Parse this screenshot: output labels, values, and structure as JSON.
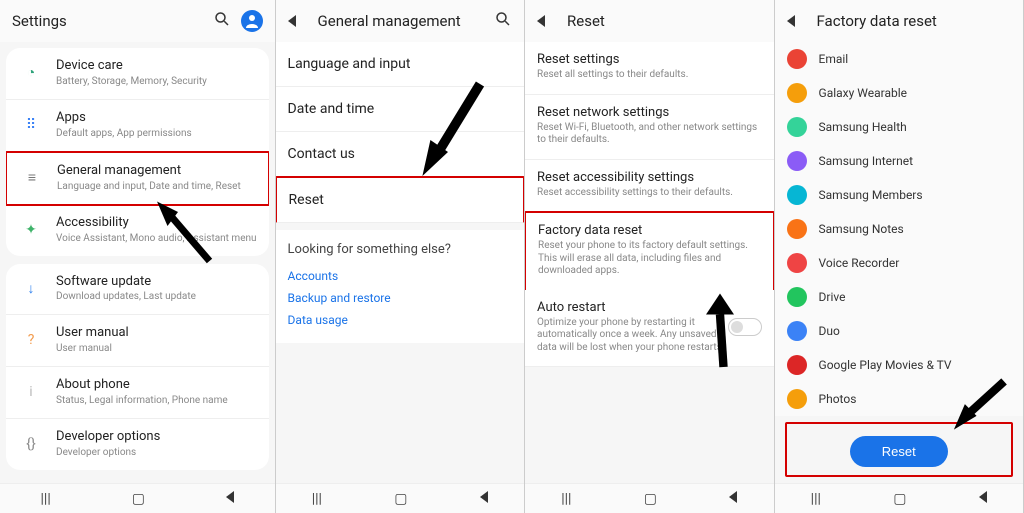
{
  "pane1": {
    "title": "Settings",
    "items": [
      {
        "label": "Device care",
        "sub": "Battery, Storage, Memory, Security",
        "icon": "◔",
        "color": "#2ea37a"
      },
      {
        "label": "Apps",
        "sub": "Default apps, App permissions",
        "icon": "⠿",
        "color": "#3b82f6"
      },
      {
        "label": "General management",
        "sub": "Language and input, Date and time, Reset",
        "icon": "≡",
        "color": "#777",
        "highlight": true
      },
      {
        "label": "Accessibility",
        "sub": "Voice Assistant, Mono audio, Assistant menu",
        "icon": "✦",
        "color": "#3fb36a"
      },
      {
        "label": "Software update",
        "sub": "Download updates, Last update",
        "icon": "↓",
        "color": "#2f80ed"
      },
      {
        "label": "User manual",
        "sub": "User manual",
        "icon": "?",
        "color": "#f2994a"
      },
      {
        "label": "About phone",
        "sub": "Status, Legal information, Phone name",
        "icon": "i",
        "color": "#bbb"
      },
      {
        "label": "Developer options",
        "sub": "Developer options",
        "icon": "{}",
        "color": "#888"
      }
    ]
  },
  "pane2": {
    "title": "General management",
    "rows": [
      "Language and input",
      "Date and time",
      "Contact us",
      "Reset"
    ],
    "highlightIndex": 3,
    "more_title": "Looking for something else?",
    "links": [
      "Accounts",
      "Backup and restore",
      "Data usage"
    ]
  },
  "pane3": {
    "title": "Reset",
    "rows": [
      {
        "lbl": "Reset settings",
        "s": "Reset all settings to their defaults."
      },
      {
        "lbl": "Reset network settings",
        "s": "Reset Wi-Fi, Bluetooth, and other network settings to their defaults."
      },
      {
        "lbl": "Reset accessibility settings",
        "s": "Reset accessibility settings to their defaults."
      },
      {
        "lbl": "Factory data reset",
        "s": "Reset your phone to its factory default settings. This will erase all data, including files and downloaded apps.",
        "highlight": true
      },
      {
        "lbl": "Auto restart",
        "s": "Optimize your phone by restarting it automatically once a week. Any unsaved data will be lost when your phone restarts.",
        "toggle": true
      }
    ]
  },
  "pane4": {
    "title": "Factory data reset",
    "apps": [
      {
        "name": "Email",
        "color": "#ea4335"
      },
      {
        "name": "Galaxy Wearable",
        "color": "#f59e0b"
      },
      {
        "name": "Samsung Health",
        "color": "#34d399"
      },
      {
        "name": "Samsung Internet",
        "color": "#8b5cf6"
      },
      {
        "name": "Samsung Members",
        "color": "#06b6d4"
      },
      {
        "name": "Samsung Notes",
        "color": "#f97316"
      },
      {
        "name": "Voice Recorder",
        "color": "#ef4444"
      },
      {
        "name": "Drive",
        "color": "#22c55e"
      },
      {
        "name": "Duo",
        "color": "#3b82f6"
      },
      {
        "name": "Google Play Movies & TV",
        "color": "#dc2626"
      },
      {
        "name": "Photos",
        "color": "#f59e0b"
      }
    ],
    "button": "Reset"
  },
  "nav": {
    "recents": "|||",
    "home": "▢",
    "back": "‹"
  }
}
